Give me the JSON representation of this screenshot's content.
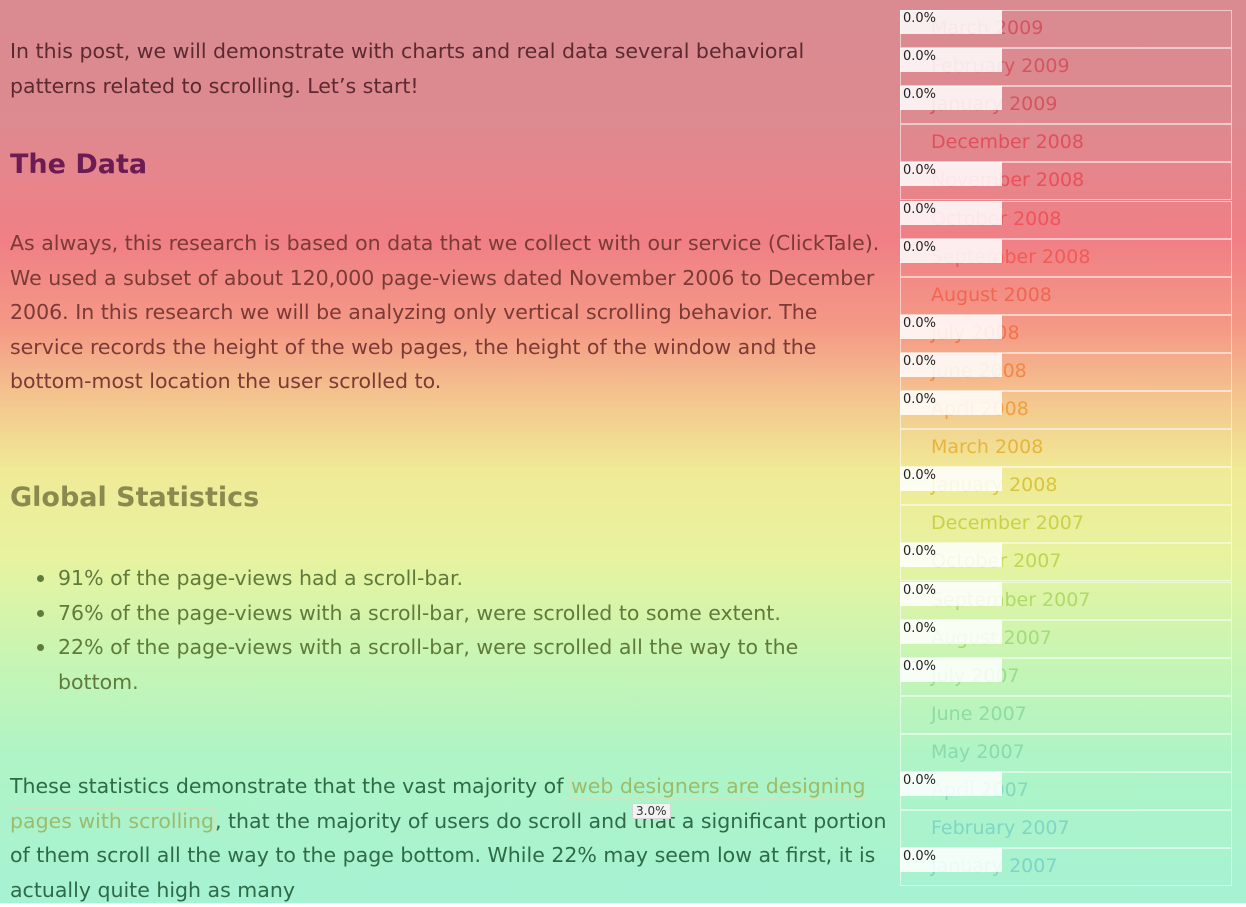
{
  "article": {
    "intro": "In this post, we will demonstrate with charts and real data several behavioral patterns related to scrolling. Let’s start!",
    "heading_data": "The Data",
    "data_paragraph": "As always, this research is based on data that we collect with our service (ClickTale). We used a subset of about 120,000 page-views dated November 2006 to December 2006. In this research we will be analyzing only vertical scrolling behavior. The service records the height of the web pages, the height of the window and the bottom-most location the user scrolled to.",
    "heading_global": "Global Statistics",
    "bullets": [
      "91% of the page-views had a scroll-bar.",
      "76% of the page-views with a scroll-bar, were scrolled to some extent.",
      "22% of the page-views with a scroll-bar, were scrolled all the way to the bottom."
    ],
    "stats_pre": "These statistics demonstrate that the vast majority of ",
    "stats_link": "web designers are designing pages with scrolling",
    "stats_post": ", that the majority of users do scroll and that a significant portion of them scroll all the way to the page bottom. While 22% may seem low at first, it is actually quite high as many",
    "link_click_pct": "3.0%"
  },
  "sidebar": {
    "archive": [
      {
        "label": "March 2009",
        "pct": "0.0%",
        "color": "#d45560"
      },
      {
        "label": "February 2009",
        "pct": "0.0%",
        "color": "#d45560"
      },
      {
        "label": "January 2009",
        "pct": "0.0%",
        "color": "#d45560"
      },
      {
        "label": "December 2008",
        "pct": "",
        "color": "#e0505c"
      },
      {
        "label": "November 2008",
        "pct": "0.0%",
        "color": "#e8505a"
      },
      {
        "label": "October 2008",
        "pct": "0.0%",
        "color": "#ee5458"
      },
      {
        "label": "September 2008",
        "pct": "0.0%",
        "color": "#f05c55"
      },
      {
        "label": "August 2008",
        "pct": "",
        "color": "#f06650"
      },
      {
        "label": "July 2008",
        "pct": "0.0%",
        "color": "#f0744c"
      },
      {
        "label": "June 2008",
        "pct": "0.0%",
        "color": "#f08848"
      },
      {
        "label": "April 2008",
        "pct": "0.0%",
        "color": "#eea040"
      },
      {
        "label": "March 2008",
        "pct": "",
        "color": "#e6b63c"
      },
      {
        "label": "January 2008",
        "pct": "0.0%",
        "color": "#d8c440"
      },
      {
        "label": "December 2007",
        "pct": "",
        "color": "#cad048"
      },
      {
        "label": "October 2007",
        "pct": "0.0%",
        "color": "#bcd656"
      },
      {
        "label": "September 2007",
        "pct": "0.0%",
        "color": "#b0da66"
      },
      {
        "label": "August 2007",
        "pct": "0.0%",
        "color": "#a4dc78"
      },
      {
        "label": "July 2007",
        "pct": "0.0%",
        "color": "#98dc8c"
      },
      {
        "label": "June 2007",
        "pct": "",
        "color": "#8edca0"
      },
      {
        "label": "May 2007",
        "pct": "",
        "color": "#88dab0"
      },
      {
        "label": "April 2007",
        "pct": "0.0%",
        "color": "#84d8bc"
      },
      {
        "label": "February 2007",
        "pct": "",
        "color": "#80d6c6"
      },
      {
        "label": "January 2007",
        "pct": "0.0%",
        "color": "#7ed4cc"
      }
    ]
  }
}
